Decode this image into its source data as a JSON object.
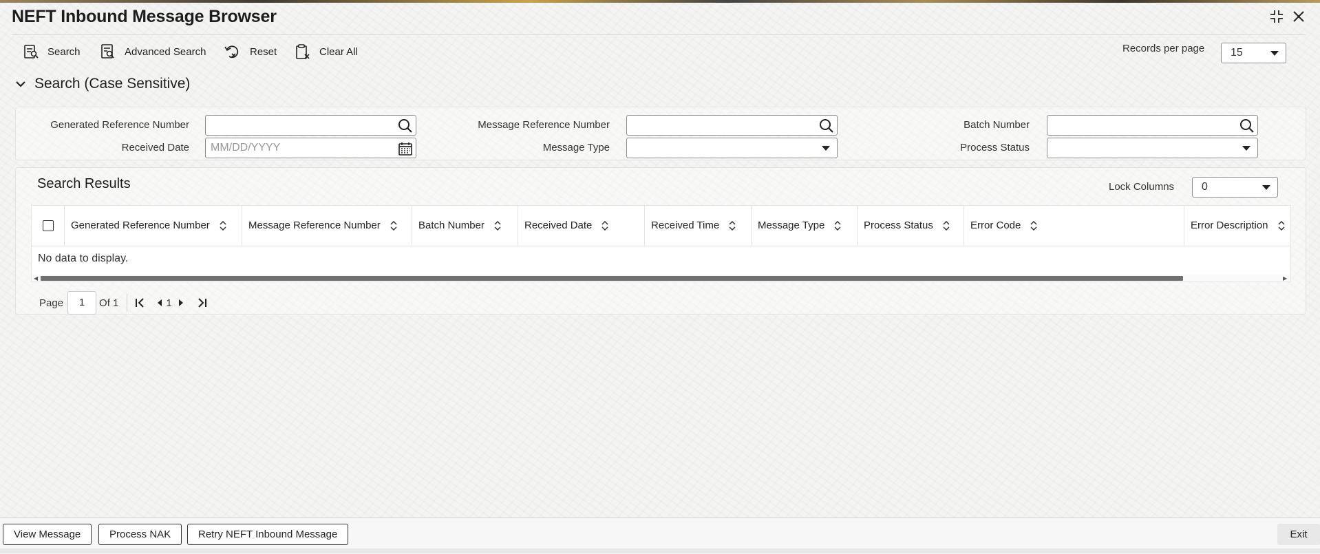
{
  "window": {
    "title": "NEFT Inbound Message Browser",
    "controls": [
      "minimize-icon",
      "close-icon"
    ]
  },
  "toolbar": {
    "search_label": "Search",
    "advanced_search_label": "Advanced Search",
    "reset_label": "Reset",
    "clear_all_label": "Clear All",
    "records_per_page_label": "Records per page",
    "records_per_page_value": "15"
  },
  "search_section": {
    "title": "Search (Case Sensitive)",
    "fields": {
      "generated_ref_label": "Generated Reference Number",
      "message_ref_label": "Message Reference Number",
      "batch_number_label": "Batch Number",
      "received_date_label": "Received Date",
      "received_date_placeholder": "MM/DD/YYYY",
      "message_type_label": "Message Type",
      "process_status_label": "Process Status"
    }
  },
  "results": {
    "title": "Search Results",
    "lock_columns_label": "Lock Columns",
    "lock_columns_value": "0",
    "columns": [
      "Generated Reference Number",
      "Message Reference Number",
      "Batch Number",
      "Received Date",
      "Received Time",
      "Message Type",
      "Process Status",
      "Error Code",
      "Error Description"
    ],
    "empty_message": "No data to display."
  },
  "pagination": {
    "page_label": "Page",
    "current_page": "1",
    "of_label": "Of 1",
    "nav_page": "1"
  },
  "footer": {
    "view_message_label": "View Message",
    "process_nak_label": "Process NAK",
    "retry_label": "Retry NEFT Inbound Message",
    "exit_label": "Exit"
  },
  "colors": {
    "accent_text": "#1d1d1d",
    "border": "#8c8c8c",
    "scrollbar": "#6f6f6f"
  }
}
